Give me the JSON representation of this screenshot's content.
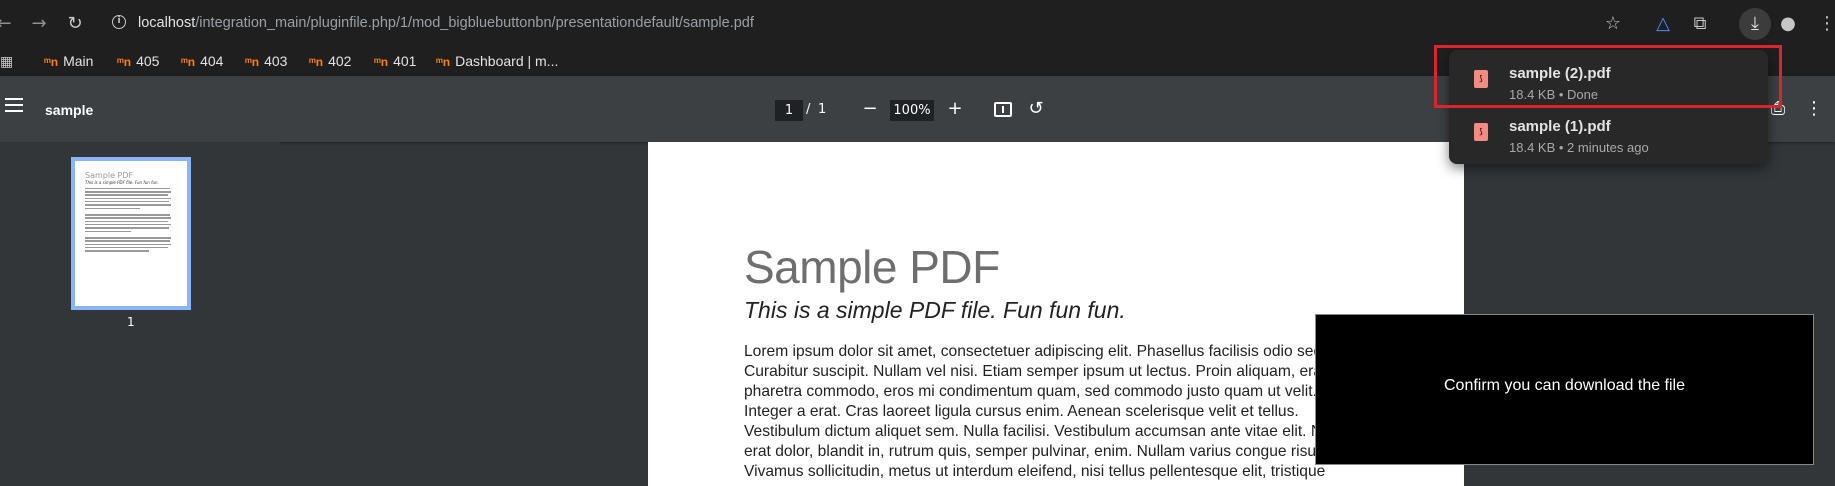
{
  "browser": {
    "url_host": "localhost",
    "url_path": "/integration_main/pluginfile.php/1/mod_bigbluebuttonbn/presentationdefault/sample.pdf"
  },
  "bookmarks": [
    {
      "label": "Main"
    },
    {
      "label": "405"
    },
    {
      "label": "404"
    },
    {
      "label": "403"
    },
    {
      "label": "402"
    },
    {
      "label": "401"
    },
    {
      "label": "Dashboard | m..."
    }
  ],
  "pdf_viewer": {
    "title": "sample",
    "current_page": "1",
    "page_separator": "/",
    "total_pages": "1",
    "zoom": "100%",
    "thumbnail_label": "1"
  },
  "pdf_content": {
    "heading": "Sample PDF",
    "subheading": "This is a simple PDF file. Fun fun fun.",
    "lines": [
      "Lorem ipsum dolor sit amet, consectetuer adipiscing elit. Phasellus facilisis odio sed mi.",
      "Curabitur suscipit. Nullam vel nisi. Etiam semper ipsum ut lectus. Proin aliquam, erat eget",
      "pharetra commodo, eros mi condimentum quam, sed commodo justo quam ut velit.",
      "Integer a erat. Cras laoreet ligula cursus enim. Aenean scelerisque velit et tellus.",
      "Vestibulum dictum aliquet sem. Nulla facilisi. Vestibulum accumsan ante vitae elit. Nulla",
      "erat dolor, blandit in, rutrum quis, semper pulvinar, enim. Nullam varius congue risus.",
      "Vivamus sollicitudin, metus ut interdum eleifend, nisi tellus pellentesque elit, tristique"
    ]
  },
  "downloads": [
    {
      "name": "sample (2).pdf",
      "meta": "18.4 KB • Done"
    },
    {
      "name": "sample (1).pdf",
      "meta": "18.4 KB • 2 minutes ago"
    }
  ],
  "overlay": {
    "message": "Confirm you can download the file"
  },
  "colors": {
    "bookmark_icon": "#f98012",
    "highlight_border": "#d9252c",
    "thumbnail_border": "#8ab4f8"
  }
}
